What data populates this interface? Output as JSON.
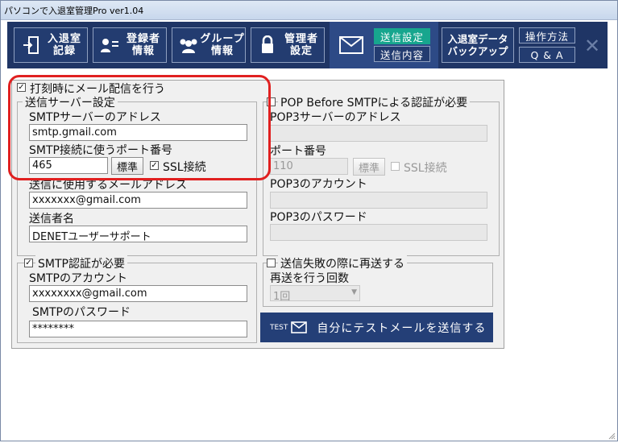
{
  "window": {
    "title": "パソコンで入退室管理Pro ver1.04"
  },
  "toolbar": {
    "entry_label": "入退室\n記録",
    "register_label": "登録者\n情報",
    "group_label": "グループ\n情報",
    "admin_label": "管理者\n設定",
    "send_settings": "送信設定",
    "send_content": "送信内容",
    "backup_label": "入退室データ\nバックアップ",
    "howto_label": "操作方法",
    "qa_label": "Q & A"
  },
  "mail": {
    "enable_label": "打刻時にメール配信を行う",
    "enable_checked": true,
    "server": {
      "legend": "送信サーバー設定",
      "address_label": "SMTPサーバーのアドレス",
      "address_value": "smtp.gmail.com",
      "port_label": "SMTP接続に使うポート番号",
      "port_value": "465",
      "std_button": "標準",
      "ssl_label": "SSL接続",
      "ssl_checked": true,
      "sender_addr_label": "送信に使用するメールアドレス",
      "sender_addr_value": "xxxxxxx@gmail.com",
      "sender_name_label": "送信者名",
      "sender_name_value": "DENETユーザーサポート"
    },
    "pop": {
      "legend": "POP Before SMTPによる認証が必要",
      "server_label": "POP3サーバーのアドレス",
      "server_value": "",
      "port_label": "ポート番号",
      "port_value": "110",
      "std_button": "標準",
      "ssl_label": "SSL接続",
      "account_label": "POP3のアカウント",
      "account_value": "",
      "password_label": "POP3のパスワード",
      "password_value": ""
    },
    "smtp_auth": {
      "legend": "SMTP認証が必要",
      "checked": true,
      "account_label": "SMTPのアカウント",
      "account_value": "xxxxxxxx@gmail.com",
      "password_label": "SMTPのパスワード",
      "password_value": "********"
    },
    "resend": {
      "legend": "送信失敗の際に再送する",
      "count_label": "再送を行う回数",
      "count_value": "1回"
    },
    "test_button": {
      "tag": "TEST",
      "label": "自分にテストメールを送信する"
    }
  },
  "colors": {
    "toolbar_bg": "#1f3565",
    "selected": "#17a68e",
    "highlight": "#e02020"
  }
}
